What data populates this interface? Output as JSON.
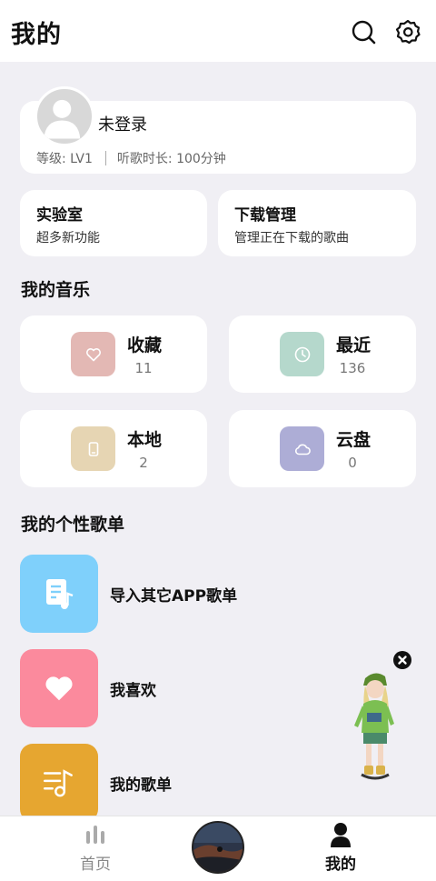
{
  "header": {
    "title": "我的",
    "search_icon": "search-icon",
    "settings_icon": "gear-icon"
  },
  "profile": {
    "login_status": "未登录",
    "level": "等级: LV1",
    "listen_time": "听歌时长: 100分钟",
    "avatar_icon": "person-avatar"
  },
  "features": [
    {
      "title": "实验室",
      "subtitle": "超多新功能"
    },
    {
      "title": "下载管理",
      "subtitle": "管理正在下载的歌曲"
    }
  ],
  "my_music": {
    "title": "我的音乐",
    "items": [
      {
        "label": "收藏",
        "count": "11",
        "icon": "heart-icon",
        "color": "#e3b8b4"
      },
      {
        "label": "最近",
        "count": "136",
        "icon": "clock-icon",
        "color": "#b5d8cc"
      },
      {
        "label": "本地",
        "count": "2",
        "icon": "phone-icon",
        "color": "#e6d5b3"
      },
      {
        "label": "云盘",
        "count": "0",
        "icon": "cloud-icon",
        "color": "#adadd6"
      }
    ]
  },
  "playlists": {
    "title": "我的个性歌单",
    "items": [
      {
        "name": "导入其它APP歌单",
        "icon": "music-file-icon",
        "color": "#7fd0fb"
      },
      {
        "name": "我喜欢",
        "icon": "heart-icon",
        "color": "#fb8a9d"
      },
      {
        "name": "我的歌单",
        "icon": "playlist-icon",
        "color": "#e6a630"
      }
    ]
  },
  "bottom_nav": {
    "tabs": [
      {
        "label": "首页",
        "icon": "equalizer-icon",
        "active": false
      },
      {
        "label": "我的",
        "icon": "person-icon",
        "active": true
      }
    ],
    "now_playing_icon": "album-disc"
  },
  "colors": {
    "background": "#f0eff4",
    "card": "#ffffff",
    "text_primary": "#111111",
    "text_secondary": "#777777",
    "tab_inactive": "#888888"
  }
}
